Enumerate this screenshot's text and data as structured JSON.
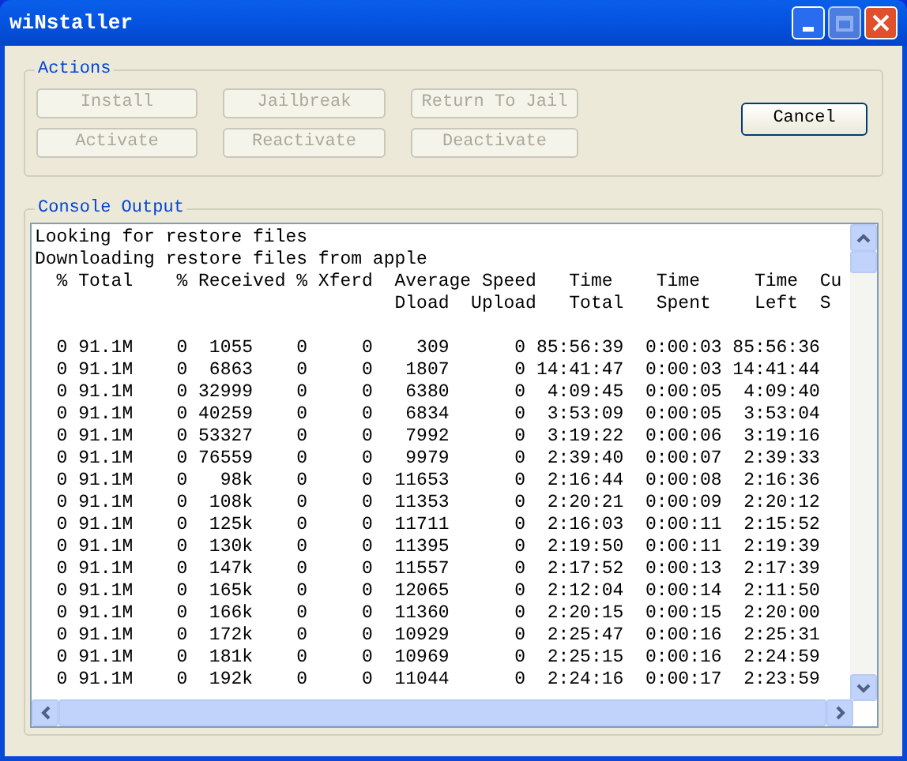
{
  "window": {
    "title": "wiNstaller"
  },
  "actions": {
    "title": "Actions",
    "buttons": [
      {
        "label": "Install",
        "disabled": true
      },
      {
        "label": "Jailbreak",
        "disabled": true
      },
      {
        "label": "Return To Jail",
        "disabled": true
      },
      {
        "label": "Activate",
        "disabled": true
      },
      {
        "label": "Reactivate",
        "disabled": true
      },
      {
        "label": "Deactivate",
        "disabled": true
      }
    ]
  },
  "cancel_button": {
    "label": "Cancel",
    "disabled": false
  },
  "console": {
    "title": "Console Output",
    "lines": [
      "Looking for restore files",
      "Downloading restore files from apple",
      "  % Total    % Received % Xferd  Average Speed   Time    Time     Time  Cu",
      "                                 Dload  Upload   Total   Spent    Left  S",
      "  0 91.1M    0  1055    0     0    309      0 85:56:39  0:00:03 85:56:36",
      "  0 91.1M    0  6863    0     0   1807      0 14:41:47  0:00:03 14:41:44",
      "  0 91.1M    0 32999    0     0   6380      0  4:09:45  0:00:05  4:09:40",
      "  0 91.1M    0 40259    0     0   6834      0  3:53:09  0:00:05  3:53:04",
      "  0 91.1M    0 53327    0     0   7992      0  3:19:22  0:00:06  3:19:16",
      "  0 91.1M    0 76559    0     0   9979      0  2:39:40  0:00:07  2:39:33",
      "  0 91.1M    0   98k    0     0  11653      0  2:16:44  0:00:08  2:16:36",
      "  0 91.1M    0  108k    0     0  11353      0  2:20:21  0:00:09  2:20:12",
      "  0 91.1M    0  125k    0     0  11711      0  2:16:03  0:00:11  2:15:52",
      "  0 91.1M    0  130k    0     0  11395      0  2:19:50  0:00:11  2:19:39",
      "  0 91.1M    0  147k    0     0  11557      0  2:17:52  0:00:13  2:17:39",
      "  0 91.1M    0  165k    0     0  12065      0  2:12:04  0:00:14  2:11:50",
      "  0 91.1M    0  166k    0     0  11360      0  2:20:15  0:00:15  2:20:00",
      "  0 91.1M    0  172k    0     0  10929      0  2:25:47  0:00:16  2:25:31",
      "  0 91.1M    0  181k    0     0  10969      0  2:25:15  0:00:16  2:24:59",
      "  0 91.1M    0  192k    0     0  11044      0  2:24:16  0:00:17  2:23:59"
    ]
  }
}
